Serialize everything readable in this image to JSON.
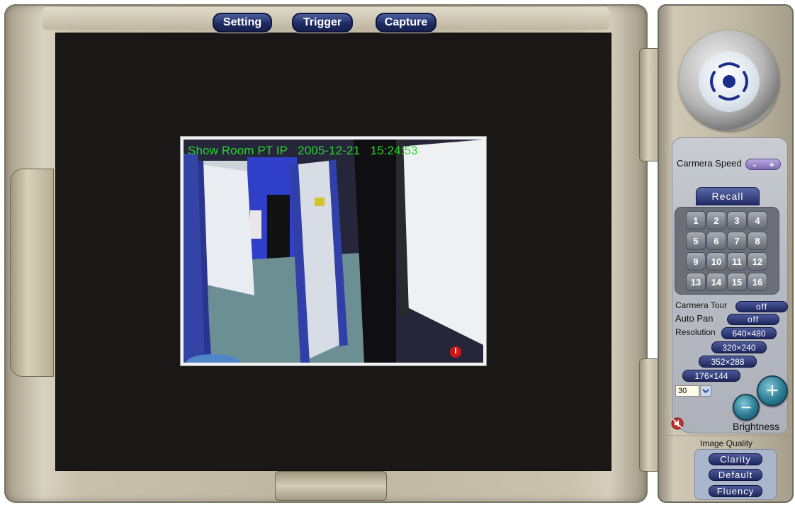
{
  "toolbar": {
    "setting": "Setting",
    "trigger": "Trigger",
    "capture": "Capture"
  },
  "video": {
    "overlay": "Show Room PT IP   2005-12-21   15:24:53"
  },
  "panel": {
    "camera_speed_label": "Carmera Speed",
    "speed_minus": "-",
    "speed_plus": "+",
    "recall": "Recall",
    "presets": [
      "1",
      "2",
      "3",
      "4",
      "5",
      "6",
      "7",
      "8",
      "9",
      "10",
      "11",
      "12",
      "13",
      "14",
      "15",
      "16"
    ],
    "camera_tour_label": "Carmera Tour",
    "camera_tour_value": "off",
    "auto_pan_label": "Auto Pan",
    "auto_pan_value": "off",
    "resolution_label": "Resolution",
    "resolutions": [
      "640×480",
      "320×240",
      "352×288",
      "176×144"
    ],
    "fps_value": "30",
    "brightness_label": "Brightness",
    "brightness_minus": "−",
    "brightness_plus": "+",
    "image_quality_label": "Image Quality",
    "quality_options": [
      "Clarity",
      "Default",
      "Fluency"
    ]
  },
  "colors": {
    "overlay_text": "#25d52b",
    "button_navy": "#1e2b63",
    "frame_tan": "#c8c0ac",
    "screen_black": "#1a1816"
  },
  "icons": {
    "ptz_joystick": "ptz-joystick-icon",
    "audio_mute": "speaker-muted-icon",
    "record_indicator": "record-indicator-icon"
  }
}
